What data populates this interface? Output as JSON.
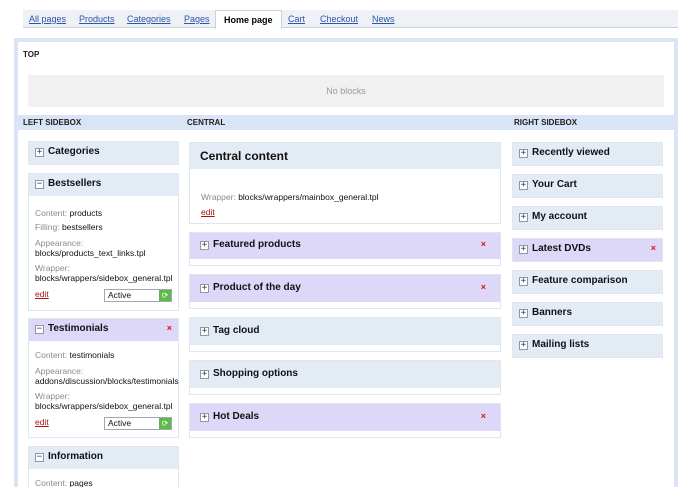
{
  "tabs": [
    {
      "label": "All pages"
    },
    {
      "label": "Products"
    },
    {
      "label": "Categories"
    },
    {
      "label": "Pages"
    },
    {
      "label": "Home page"
    },
    {
      "label": "Cart"
    },
    {
      "label": "Checkout"
    },
    {
      "label": "News"
    }
  ],
  "sections": {
    "top": "TOP",
    "no_blocks": "No blocks",
    "left": "LEFT SIDEBOX",
    "central": "CENTRAL",
    "right": "RIGHT SIDEBOX"
  },
  "left_blocks": {
    "categories": {
      "title": "Categories"
    },
    "bestsellers": {
      "title": "Bestsellers",
      "content_label": "Content:",
      "content": "products",
      "filling_label": "Filling:",
      "filling": "bestsellers",
      "appearance_label": "Appearance:",
      "appearance": "blocks/products_text_links.tpl",
      "wrapper_label": "Wrapper:",
      "wrapper": "blocks/wrappers/sidebox_general.tpl",
      "edit": "edit",
      "status": "Active"
    },
    "testimonials": {
      "title": "Testimonials",
      "close": "×",
      "content_label": "Content:",
      "content": "testimonials",
      "appearance_label": "Appearance:",
      "appearance": "addons/discussion/blocks/testimonials",
      "wrapper_label": "Wrapper:",
      "wrapper": "blocks/wrappers/sidebox_general.tpl",
      "edit": "edit",
      "status": "Active"
    },
    "information": {
      "title": "Information",
      "content_label": "Content:",
      "content": "pages"
    }
  },
  "central": {
    "main": {
      "title": "Central content",
      "wrapper_label": "Wrapper:",
      "wrapper": "blocks/wrappers/mainbox_general.tpl",
      "edit": "edit"
    },
    "blocks": [
      {
        "title": "Featured products",
        "close": "×"
      },
      {
        "title": "Product of the day",
        "close": "×"
      },
      {
        "title": "Tag cloud"
      },
      {
        "title": "Shopping options"
      },
      {
        "title": "Hot Deals",
        "close": "×"
      }
    ]
  },
  "right_blocks": [
    {
      "title": "Recently viewed"
    },
    {
      "title": "Your Cart"
    },
    {
      "title": "My account"
    },
    {
      "title": "Latest DVDs",
      "close": "×"
    },
    {
      "title": "Feature comparison"
    },
    {
      "title": "Banners"
    },
    {
      "title": "Mailing lists"
    }
  ],
  "icons": {
    "expand": "+",
    "collapse": "−",
    "refresh": "⟳"
  },
  "colors": {
    "header_blue": "#e3ecf5",
    "header_lavender": "#ddd8f8",
    "frame": "#d9e5f6",
    "link": "#2c57a7",
    "close": "#dd1111"
  }
}
